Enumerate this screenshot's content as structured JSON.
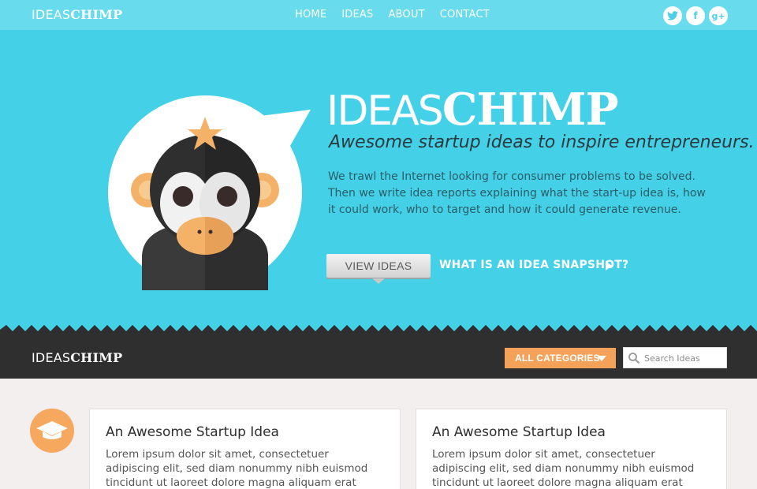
{
  "brand": {
    "thin": "IDEAS",
    "bold": "CHIMP"
  },
  "nav": {
    "items": [
      "HOME",
      "IDEAS",
      "ABOUT",
      "CONTACT"
    ]
  },
  "social": {
    "twitter": "t",
    "facebook": "f",
    "googleplus": "g+"
  },
  "hero": {
    "title_thin": "IDEAS",
    "title_bold": "CHIMP",
    "tagline": "Awesome startup ideas to inspire entrepreneurs.",
    "description": "We trawl the Internet looking for consumer problems to be solved. Then  we write idea reports explaining what the start-up idea is, how it could work, who to target and how it could generate revenue.",
    "view_button": "VIEW IDEAS",
    "snapshot_link": "WHAT IS AN IDEA SNAPSHOT?"
  },
  "filterbar": {
    "categories_label": "ALL CATEGORIES",
    "search_placeholder": "Search Ideas"
  },
  "cards": [
    {
      "title": "An Awesome Startup Idea",
      "body": "Lorem ipsum dolor sit amet, consectetuer adipiscing elit, sed diam nonummy nibh euismod tincidunt ut laoreet dolore magna aliquam erat volutpat."
    },
    {
      "title": "An Awesome Startup Idea",
      "body": "Lorem ipsum dolor sit amet, consectetuer adipiscing elit, sed diam nonummy nibh euismod tincidunt ut laoreet dolore magna aliquam erat volutpat."
    }
  ],
  "icons": [
    "twitter-icon",
    "facebook-icon",
    "google-plus-icon",
    "caret-down-icon",
    "search-icon",
    "graduation-cap-icon",
    "play-arrow-icon",
    "chimp-mascot-icon"
  ],
  "colors": {
    "hero": "#44d0e6",
    "topbar": "#68dbec",
    "dark": "#2f2f2f",
    "accent": "#f4a259"
  }
}
